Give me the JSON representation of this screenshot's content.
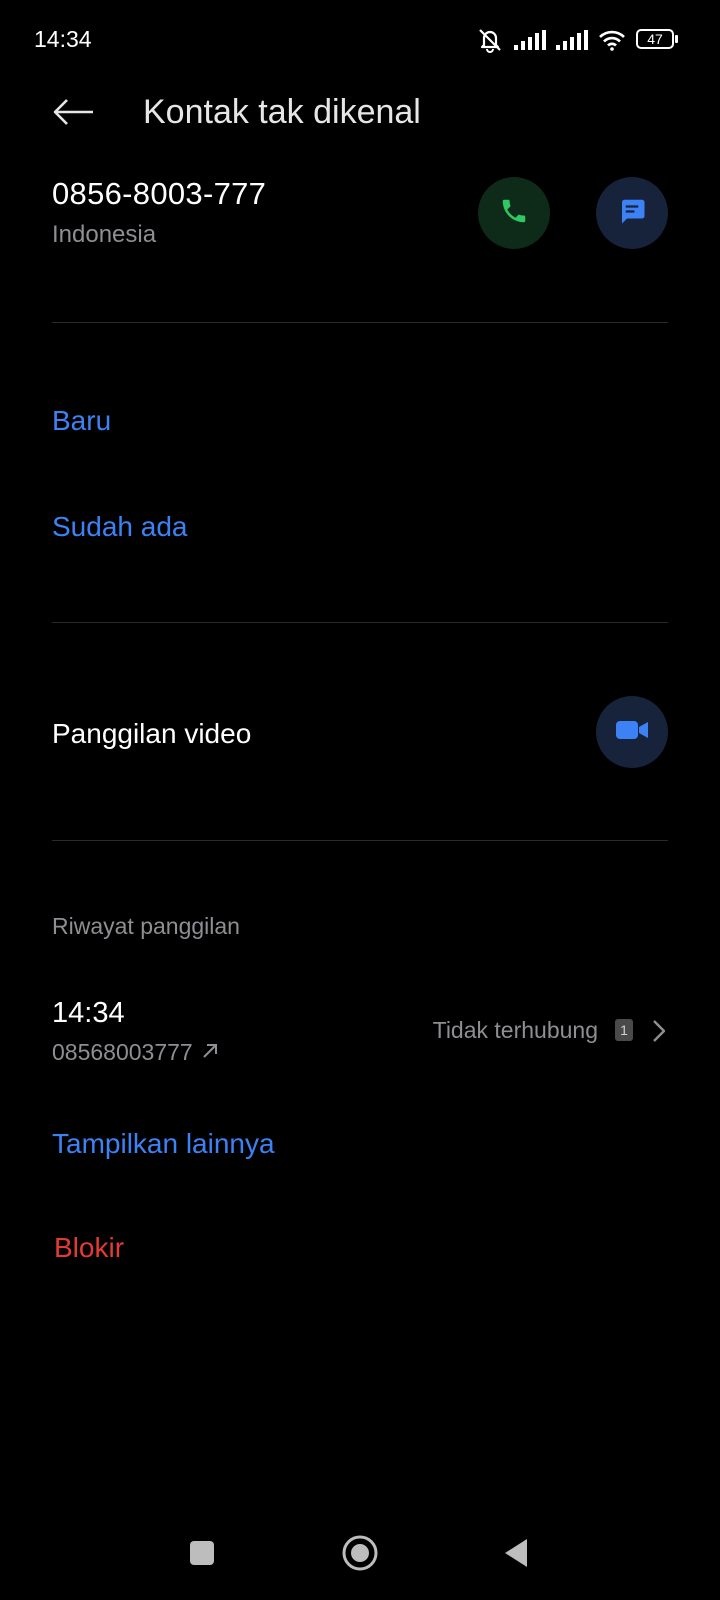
{
  "status_bar": {
    "time": "14:34",
    "battery": "47",
    "icons": [
      "mute-icon",
      "signal-icon",
      "signal-icon",
      "wifi-icon",
      "battery-icon"
    ]
  },
  "header": {
    "title": "Kontak tak dikenal",
    "back_icon": "arrow-left-icon"
  },
  "contact": {
    "number": "0856-8003-777",
    "country": "Indonesia",
    "call_icon": "phone-icon",
    "message_icon": "message-icon"
  },
  "add_options": {
    "new": "Baru",
    "existing": "Sudah ada"
  },
  "video": {
    "label": "Panggilan video",
    "icon": "video-camera-icon"
  },
  "history": {
    "section_label": "Riwayat panggilan",
    "entries": [
      {
        "time": "14:34",
        "number": "08568003777",
        "direction_icon": "outgoing-arrow-icon",
        "status": "Tidak terhubung",
        "sim": "1"
      }
    ],
    "show_more": "Tampilkan lainnya"
  },
  "block_label": "Blokir",
  "colors": {
    "background": "#000000",
    "accent_blue": "#3d82f5",
    "call_green": "#2fc862",
    "danger_red": "#e53935",
    "secondary_text": "#8e8e93"
  },
  "nav_bar": {
    "icons": [
      "recents-square-icon",
      "home-circle-icon",
      "back-triangle-icon"
    ]
  }
}
